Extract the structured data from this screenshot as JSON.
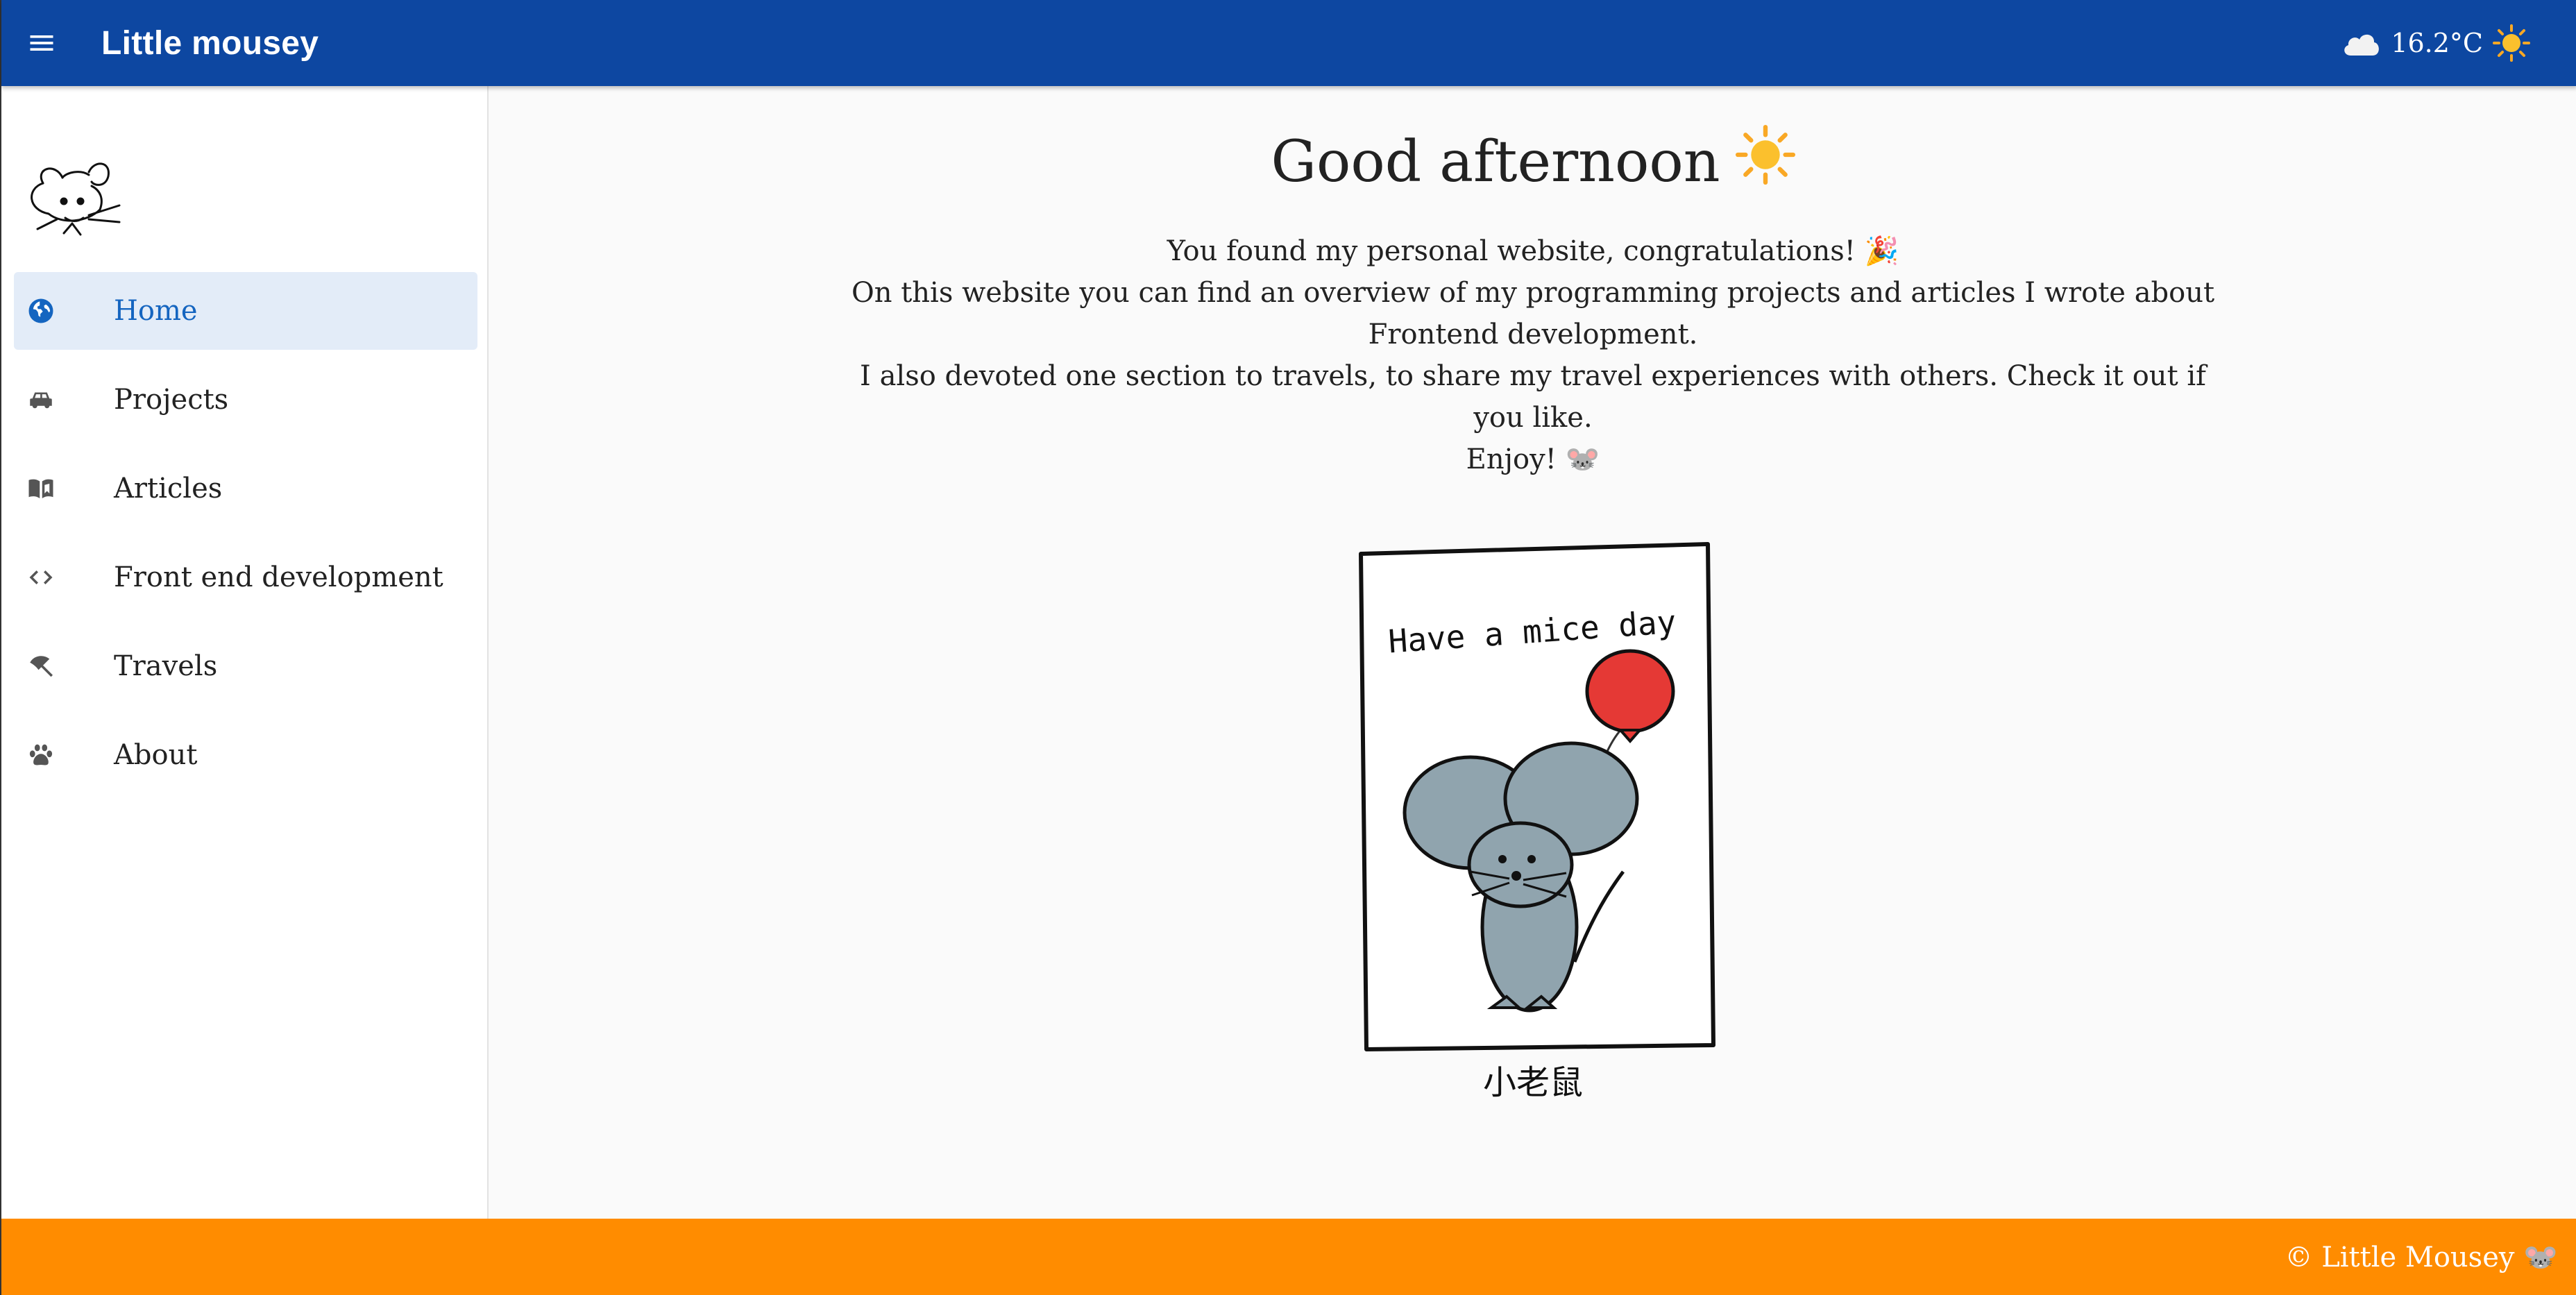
{
  "app": {
    "title": "Little mousey",
    "menu_icon": "menu-icon"
  },
  "weather": {
    "temperature": "16.2°C",
    "cloud_icon": "cloud-icon",
    "sun_icon": "sun-icon"
  },
  "sidebar": {
    "logo": "mouse-logo",
    "items": [
      {
        "label": "Home",
        "icon": "globe-icon",
        "active": true
      },
      {
        "label": "Projects",
        "icon": "car-icon",
        "active": false
      },
      {
        "label": "Articles",
        "icon": "book-icon",
        "active": false
      },
      {
        "label": "Front end development",
        "icon": "code-icon",
        "active": false
      },
      {
        "label": "Travels",
        "icon": "beach-umbrella-icon",
        "active": false
      },
      {
        "label": "About",
        "icon": "paw-icon",
        "active": false
      }
    ]
  },
  "main": {
    "greeting": "Good afternoon",
    "greeting_icon": "sun-icon",
    "intro": [
      "You found my personal website, congratulations! 🎉",
      "On this website you can find an overview of my programming projects and articles I wrote about Frontend development.",
      "I also devoted one section to travels, to share my travel experiences with others. Check it out if you like.",
      "Enjoy! 🐭"
    ],
    "card_text": "Have a mice day",
    "caption": "小老鼠"
  },
  "footer": {
    "text": "© Little Mousey 🐭"
  },
  "colors": {
    "appbar": "#0d47a1",
    "footer": "#ff8c00",
    "active_nav_bg": "#e3ecf8",
    "active_nav_text": "#1565c0",
    "sun": "#f9a825",
    "balloon": "#e53935",
    "mouse": "#90a4ae"
  }
}
